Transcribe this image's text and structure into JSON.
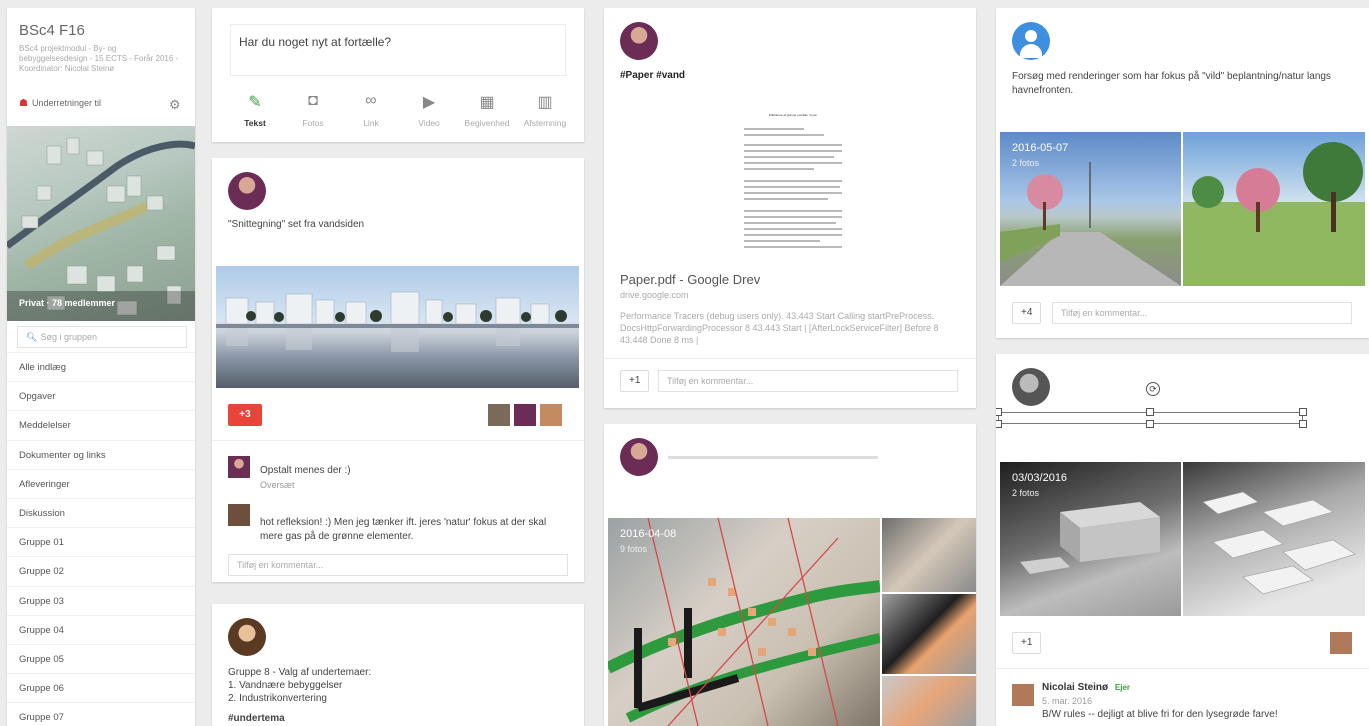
{
  "sidebar": {
    "title": "BSc4 F16",
    "description": "BSc4 projektmodul - By- og bebyggelsesdesign - 15 ECTS - Forår 2016 - Koordinator: Nicolai Steinø",
    "note": "Underretninger til",
    "cover_meta": "Privat  ·  78 medlemmer",
    "search_placeholder": "Søg i gruppen",
    "nav": [
      "Alle indlæg",
      "Opgaver",
      "Meddelelser",
      "Dokumenter og links",
      "Afleveringer",
      "Diskussion",
      "Gruppe 01",
      "Gruppe 02",
      "Gruppe 03",
      "Gruppe 04",
      "Gruppe 05",
      "Gruppe 06",
      "Gruppe 07"
    ]
  },
  "composer": {
    "placeholder": "Har du noget nyt at fortælle?",
    "tools": [
      {
        "label": "Tekst",
        "icon": "pencil-icon",
        "glyph": "✎"
      },
      {
        "label": "Fotos",
        "icon": "camera-icon",
        "glyph": "◘"
      },
      {
        "label": "Link",
        "icon": "link-icon",
        "glyph": "∞"
      },
      {
        "label": "Video",
        "icon": "video-icon",
        "glyph": "▶"
      },
      {
        "label": "Begivenhed",
        "icon": "calendar-icon",
        "glyph": "▦"
      },
      {
        "label": "Afstemning",
        "icon": "poll-icon",
        "glyph": "▥"
      }
    ]
  },
  "post1": {
    "text": "\"Snittegning\" set fra vandsiden",
    "plus_label": "+3",
    "comments": [
      {
        "text": "Opstalt menes der :)",
        "meta": "Oversæt"
      },
      {
        "text": "hot refleksion! :) Men jeg tænker ift. jeres 'natur' fokus at der skal mere gas på de grønne elementer."
      }
    ],
    "comment_placeholder": "Tilføj en kommentar..."
  },
  "post2": {
    "text_lines": [
      "Gruppe 8 - Valg af undertemaer:",
      "1. Vandnære bebyggelser",
      "2. Industrikonvertering"
    ],
    "tag": "#undertema"
  },
  "pdf_post": {
    "tags": "#Paper #vand",
    "doc_heading": "Effekterne af grønne områder i byen",
    "title": "Paper.pdf - Google Drev",
    "domain": "drive.google.com",
    "description": "Performance Tracers (debug users only). 43.443 Start Calling startPreProcess. DocsHttpForwardingProcessor 8 43.443 Start | [AfterLockServiceFilter] Before 8 43.448 Done 8 ms |",
    "plus_label": "+1",
    "comment_placeholder": "Tilføj en kommentar..."
  },
  "plan_post": {
    "date": "2016-04-08",
    "count": "9 fotos"
  },
  "right_post1": {
    "text": "Forsøg med renderinger som har fokus på \"vild\" beplantning/natur langs havnefronten.",
    "date": "2016-05-07",
    "count": "2 fotos",
    "plus_label": "+4",
    "comment_placeholder": "Tilføj en kommentar..."
  },
  "right_post2": {
    "date": "03/03/2016",
    "count": "2 fotos",
    "plus_label": "+1",
    "comment_author": "Nicolai Steinø",
    "comment_badge": "Ejer",
    "comment_date": "5. mar. 2016",
    "comment_text": "B/W rules -- dejligt at blive fri for den lysegrøde farve!"
  },
  "colors": {
    "accent_green": "#3aa13e",
    "plus_red": "#e8443a",
    "link_blue": "#3a7ce0"
  }
}
